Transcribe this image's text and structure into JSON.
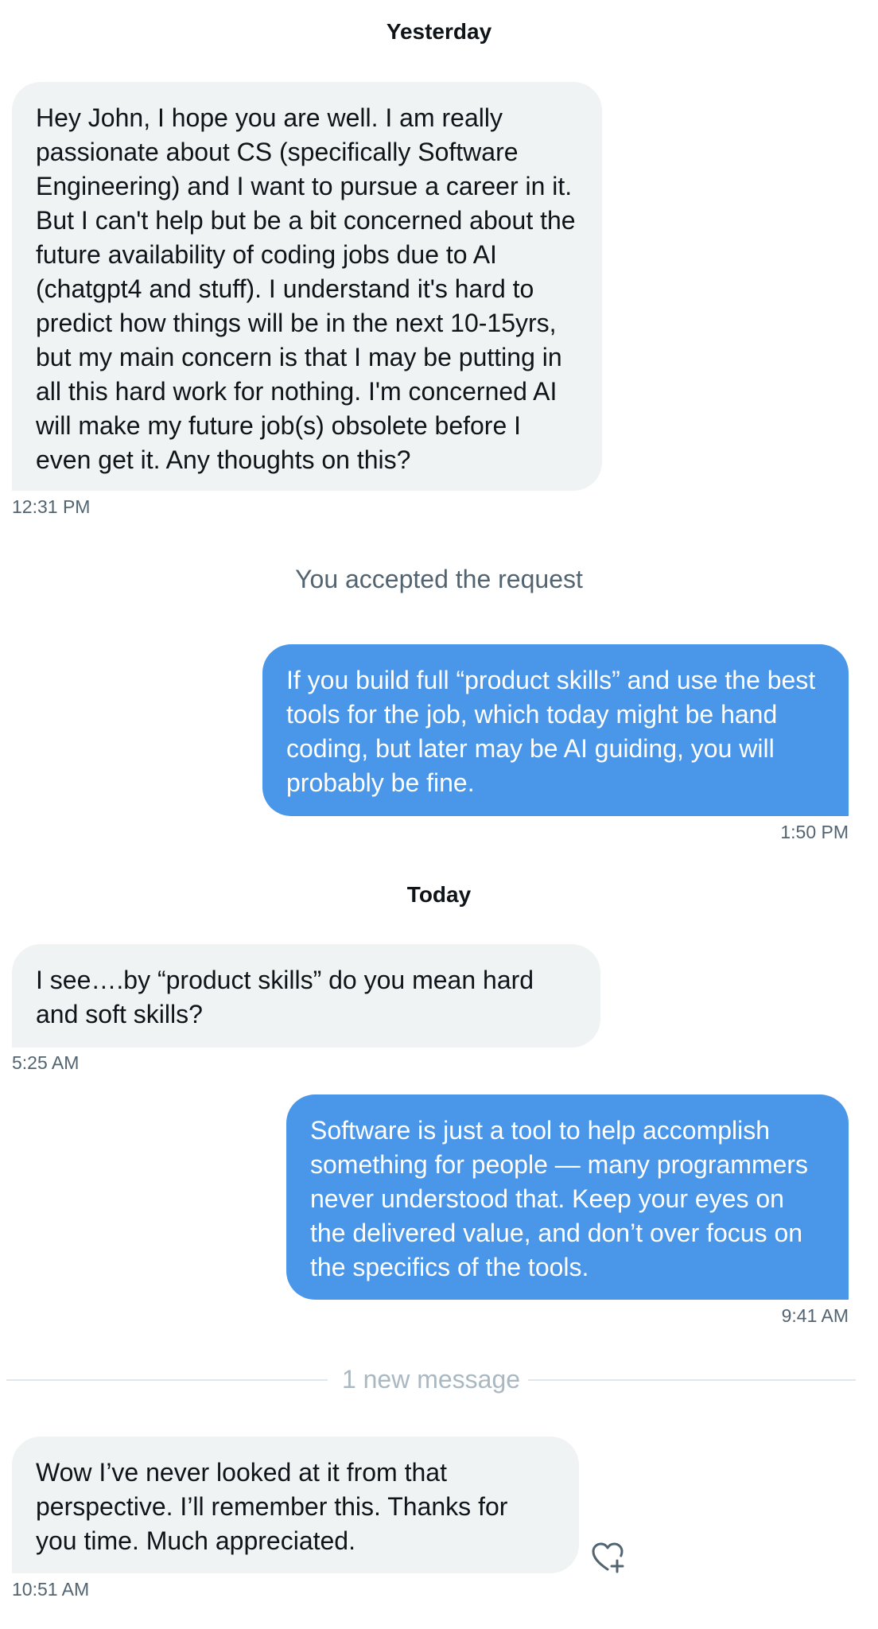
{
  "days": {
    "yesterday": "Yesterday",
    "today": "Today"
  },
  "system": {
    "accepted": "You accepted the request"
  },
  "messages": [
    {
      "direction": "incoming",
      "text": "Hey John, I hope you are well. I am really passionate about CS (specifically Software Engineering) and I want to pursue a career in it. But I can't help but be a bit concerned about the future availability of coding jobs due to AI (chatgpt4 and stuff). I understand it's hard to predict how things will be in the next 10-15yrs, but my main concern is that I may be putting in all this hard work for nothing. I'm concerned AI will make my future job(s) obsolete before I even get it. Any thoughts on this?",
      "time": "12:31 PM"
    },
    {
      "direction": "outgoing",
      "text": "If you build full “product skills” and use the best tools for the job, which today might be hand coding, but later may be AI guiding, you will probably be fine.",
      "time": "1:50 PM"
    },
    {
      "direction": "incoming",
      "text": "I see….by “product skills” do you mean hard and soft skills?",
      "time": "5:25 AM"
    },
    {
      "direction": "outgoing",
      "text": "Software is just a tool to help accomplish something for people — many programmers never understood that. Keep your eyes on the delivered value, and don’t over focus on the specifics of the tools.",
      "time": "9:41 AM"
    },
    {
      "direction": "incoming",
      "text": "Wow I’ve never looked at it from that perspective. I’ll remember this. Thanks for you time. Much appreciated.",
      "time": "10:51 AM"
    }
  ],
  "divider": {
    "new_messages": "1 new message"
  },
  "icons": {
    "react": "heart-plus-icon"
  },
  "colors": {
    "outgoing_bubble": "#4a96e8",
    "incoming_bubble": "#eff3f4",
    "timestamp": "#536471",
    "new_message_divider": "#aab8c2"
  }
}
